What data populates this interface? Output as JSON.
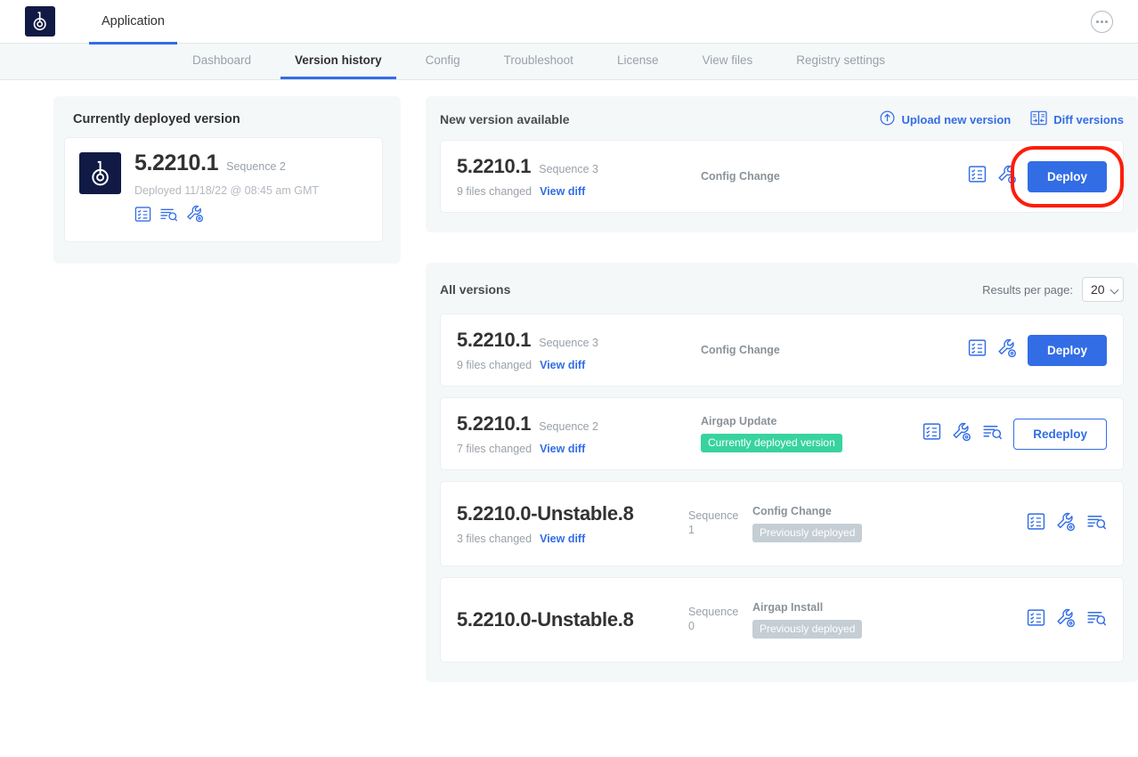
{
  "topbar": {
    "app_label": "Application",
    "logo_icon": "app-logo-b-icon",
    "more_icon": "more-options-icon"
  },
  "subnav": {
    "items": [
      {
        "label": "Dashboard",
        "active": false
      },
      {
        "label": "Version history",
        "active": true
      },
      {
        "label": "Config",
        "active": false
      },
      {
        "label": "Troubleshoot",
        "active": false
      },
      {
        "label": "License",
        "active": false
      },
      {
        "label": "View files",
        "active": false
      },
      {
        "label": "Registry settings",
        "active": false
      }
    ]
  },
  "deployed": {
    "title": "Currently deployed version",
    "version": "5.2210.1",
    "sequence": "Sequence 2",
    "deployed_at": "Deployed 11/18/22 @ 08:45 am GMT",
    "icons": [
      "config-checklist-icon",
      "logs-icon",
      "troubleshoot-wrench-icon"
    ]
  },
  "new_version": {
    "title": "New version available",
    "upload_label": "Upload new version",
    "upload_icon": "upload-arrow-icon",
    "diff_label": "Diff versions",
    "diff_icon": "diff-versions-icon",
    "row": {
      "version": "5.2210.1",
      "sequence": "Sequence 3",
      "files_changed": "9 files changed",
      "view_diff": "View diff",
      "status_type": "Config Change",
      "badge": "",
      "button": "Deploy",
      "icons": [
        "config-checklist-icon",
        "troubleshoot-wrench-icon"
      ],
      "highlighted": true
    }
  },
  "all_versions": {
    "title": "All versions",
    "results_per_page_label": "Results per page:",
    "results_per_page_value": "20",
    "results_per_page_options": [
      "20"
    ],
    "rows": [
      {
        "version": "5.2210.1",
        "version_inline": true,
        "sequence": "Sequence 3",
        "files_changed": "9 files changed",
        "view_diff": "View diff",
        "status_type": "Config Change",
        "badge": "",
        "badge_kind": "",
        "button": "Deploy",
        "button_kind": "primary",
        "icons": [
          "config-checklist-icon",
          "troubleshoot-wrench-icon"
        ]
      },
      {
        "version": "5.2210.1",
        "version_inline": true,
        "sequence": "Sequence 2",
        "files_changed": "7 files changed",
        "view_diff": "View diff",
        "status_type": "Airgap Update",
        "badge": "Currently deployed version",
        "badge_kind": "green",
        "button": "Redeploy",
        "button_kind": "outline",
        "icons": [
          "config-checklist-icon",
          "troubleshoot-wrench-icon",
          "logs-icon"
        ]
      },
      {
        "version": "5.2210.0-Unstable.8",
        "version_inline": false,
        "sequence": "Sequence 1",
        "files_changed": "3 files changed",
        "view_diff": "View diff",
        "status_type": "Config Change",
        "badge": "Previously deployed",
        "badge_kind": "grey",
        "button": "",
        "button_kind": "",
        "icons": [
          "config-checklist-icon",
          "troubleshoot-wrench-icon",
          "logs-icon"
        ]
      },
      {
        "version": "5.2210.0-Unstable.8",
        "version_inline": false,
        "sequence": "Sequence 0",
        "files_changed": "",
        "view_diff": "",
        "status_type": "Airgap Install",
        "badge": "Previously deployed",
        "badge_kind": "grey",
        "button": "",
        "button_kind": "",
        "icons": [
          "config-checklist-icon",
          "troubleshoot-wrench-icon",
          "logs-icon"
        ]
      }
    ]
  },
  "colors": {
    "accent_blue": "#326de6",
    "navy": "#111a44",
    "green_badge": "#38d39f",
    "grey_badge": "#c4ced4",
    "panel_bg": "#f5f8f9",
    "highlight_ring": "#fc1d0a"
  }
}
